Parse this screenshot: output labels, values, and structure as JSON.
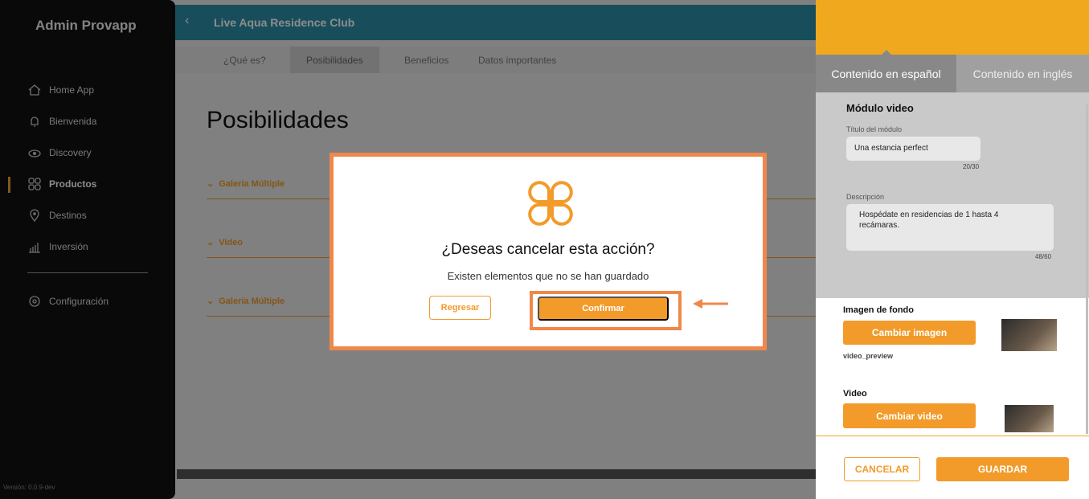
{
  "app": {
    "brand": "Admin Provapp",
    "version": "Versión: 0.0.9-dev"
  },
  "sidebar": {
    "items": [
      {
        "label": "Home App",
        "icon": "home-icon"
      },
      {
        "label": "Bienvenida",
        "icon": "bell-icon"
      },
      {
        "label": "Discovery",
        "icon": "eye-icon"
      },
      {
        "label": "Productos",
        "icon": "grid-icon",
        "active": true
      },
      {
        "label": "Destinos",
        "icon": "pin-icon"
      },
      {
        "label": "Inversión",
        "icon": "chart-icon"
      }
    ],
    "config_label": "Configuración"
  },
  "header": {
    "title": "Live Aqua Residence Club"
  },
  "tabs": [
    "¿Qué es?",
    "Posibilidades",
    "Beneficios",
    "Datos importantes"
  ],
  "main": {
    "title": "Posibilidades",
    "sections": [
      "Galería Múltiple",
      "Video",
      "Galería Múltiple"
    ]
  },
  "modal": {
    "title": "¿Deseas cancelar esta acción?",
    "subtitle": "Existen elementos que no se han guardado",
    "back_label": "Regresar",
    "confirm_label": "Confirmar"
  },
  "panel": {
    "tab_es": "Contenido en español",
    "tab_en": "Contenido en inglés",
    "module_title": "Módulo video",
    "title_label": "Título del módulo",
    "title_value": "Una estancia perfect",
    "title_count": "20/30",
    "desc_label": "Descripción",
    "desc_value": "Hospédate en residencias de 1 hasta 4 recámaras.",
    "desc_count": "48/60",
    "bg_label": "Imagen de fondo",
    "change_image": "Cambiar imagen",
    "image_caption": "video_preview",
    "video_label": "Video",
    "change_video": "Cambiar video",
    "cancel": "CANCELAR",
    "save": "GUARDAR"
  },
  "colors": {
    "accent": "#f29b2a",
    "highlight": "#f0884a",
    "header_teal": "#2d8fa6",
    "panel_header": "#f0a81e"
  }
}
